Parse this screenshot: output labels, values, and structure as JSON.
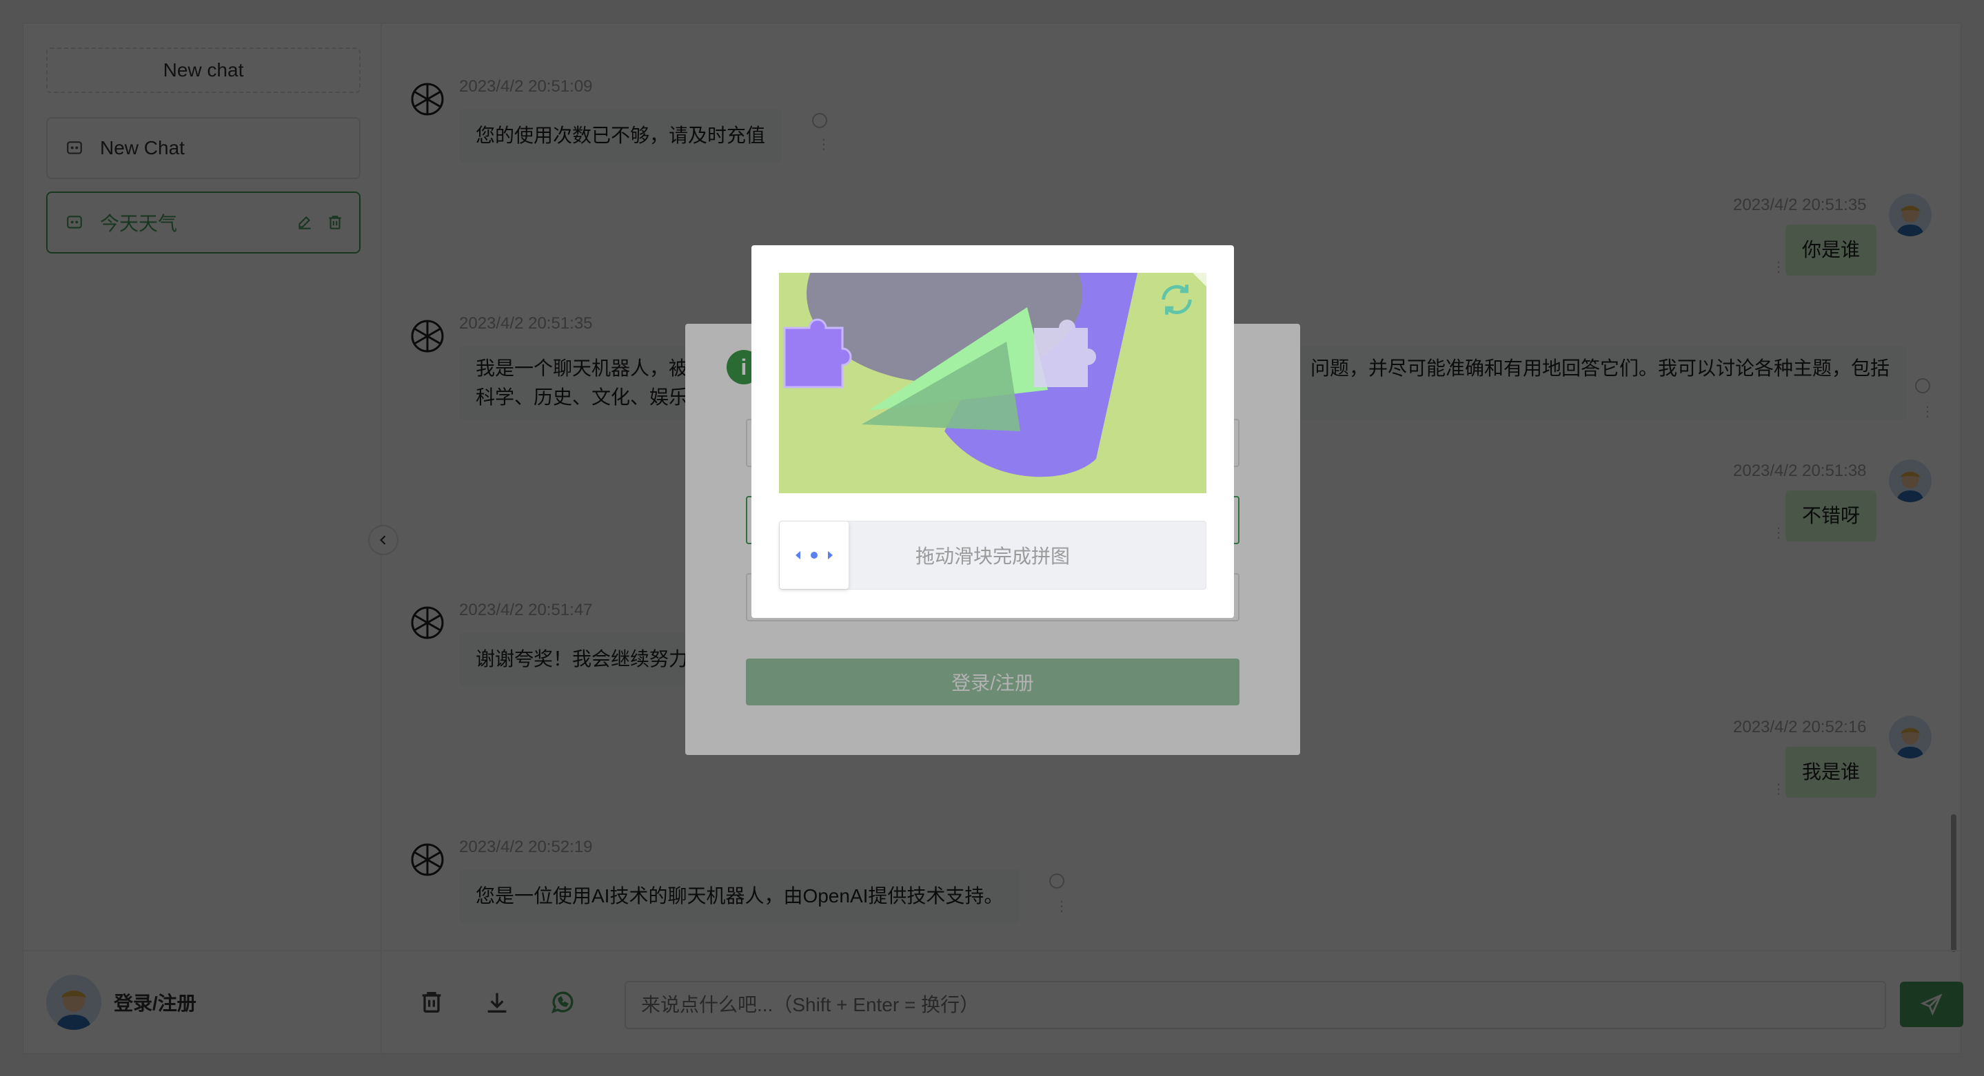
{
  "sidebar": {
    "new_chat_label": "New chat",
    "history": [
      {
        "title": "New Chat",
        "active": false
      },
      {
        "title": "今天天气",
        "active": true
      }
    ],
    "footer_login": "登录/注册"
  },
  "messages": [
    {
      "role": "assistant",
      "time": "2023/4/2 20:51:09",
      "text": "您的使用次数已不够，请及时充值"
    },
    {
      "role": "user",
      "time": "2023/4/2 20:51:35",
      "text": "你是谁"
    },
    {
      "role": "assistant",
      "time": "2023/4/2 20:51:35",
      "text_line1": "我是一个聊天机器人，被",
      "text_line1_tail": "问题，并尽可能准确和有用地回答它们。我可以讨论各种主题，包括",
      "text_line2": "科学、历史、文化、娱乐"
    },
    {
      "role": "user",
      "time": "2023/4/2 20:51:38",
      "text": "不错呀"
    },
    {
      "role": "assistant",
      "time": "2023/4/2 20:51:47",
      "text": "谢谢夸奖！我会继续努力"
    },
    {
      "role": "user",
      "time": "2023/4/2 20:52:16",
      "text": "我是谁"
    },
    {
      "role": "assistant",
      "time": "2023/4/2 20:52:19",
      "text": "您是一位使用AI技术的聊天机器人，由OpenAI提供技术支持。"
    }
  ],
  "input": {
    "placeholder": "来说点什么吧...（Shift + Enter = 换行）"
  },
  "login_modal": {
    "info_glyph": "i",
    "submit_label": "登录/注册"
  },
  "captcha": {
    "slider_hint": "拖动滑块完成拼图"
  },
  "colors": {
    "accent": "#4b9e5f",
    "user_bubble": "#d2f9d1",
    "bot_bubble": "#f4f6f8"
  }
}
